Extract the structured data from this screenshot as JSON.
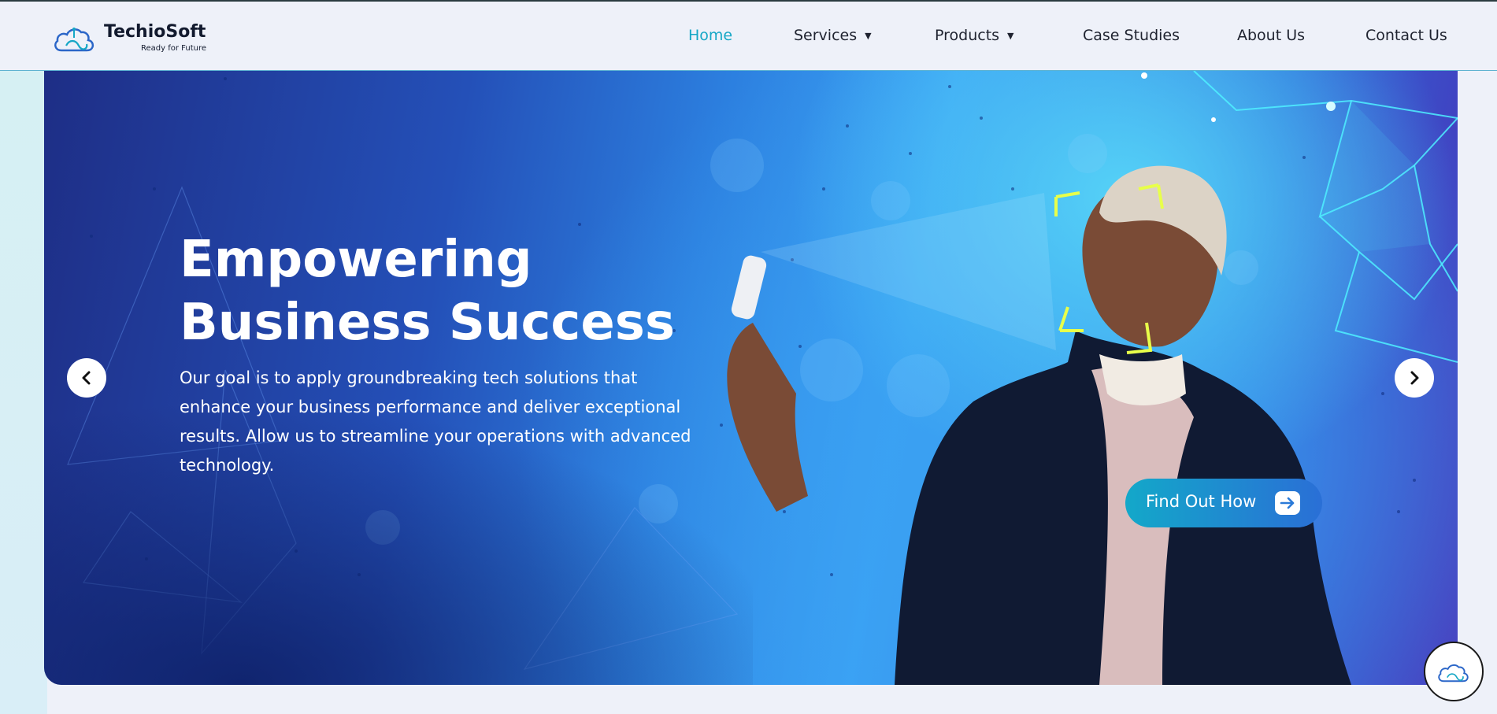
{
  "brand": {
    "name": "TechioSoft",
    "tagline": "Ready for Future",
    "accent_color": "#15a7c6"
  },
  "nav": {
    "items": [
      {
        "label": "Home",
        "active": true
      },
      {
        "label": "Services",
        "dropdown": true
      },
      {
        "label": "Products",
        "dropdown": true
      },
      {
        "label": "Case Studies"
      },
      {
        "label": "About Us"
      },
      {
        "label": "Contact Us"
      }
    ],
    "caret": "▼"
  },
  "hero": {
    "title_line1": "Empowering",
    "title_line2": "Business Success",
    "description": "Our goal is to apply groundbreaking tech solutions that enhance your business performance and deliver exceptional results. Allow us to streamline your operations with advanced technology.",
    "cta_label": "Find Out How",
    "cta_icon": "arrow-right-icon",
    "prev_icon": "chevron-left-icon",
    "next_icon": "chevron-right-icon",
    "image": "man-taking-selfie-face-scan"
  },
  "chat_widget": {
    "icon": "cloud-logo-icon"
  }
}
